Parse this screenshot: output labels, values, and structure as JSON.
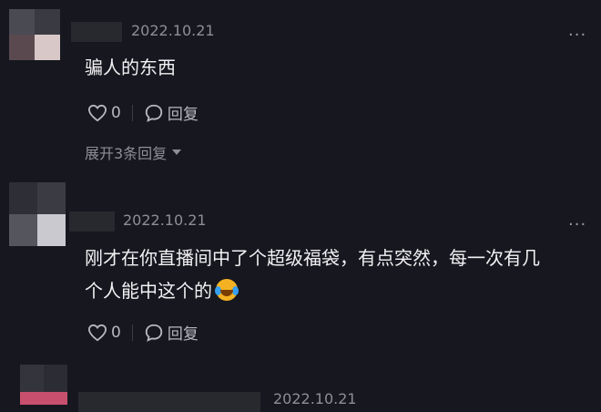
{
  "comments": [
    {
      "date": "2022.10.21",
      "text": "骗人的东西",
      "likes": "0",
      "reply_label": "回复",
      "expand_label": "展开3条回复",
      "more": "···"
    },
    {
      "date": "2022.10.21",
      "text_line1": "刚才在你直播间中了个超级福袋，有点突然，每一次有几",
      "text_line2": "个人能中这个的",
      "emoji": "laughing-crying-emoji",
      "likes": "0",
      "reply_label": "回复",
      "more": "···"
    },
    {
      "date": "2022.10.21"
    }
  ],
  "colors": {
    "background": "#17171f",
    "text": "#f2f2f4",
    "muted": "#8e8e96"
  }
}
